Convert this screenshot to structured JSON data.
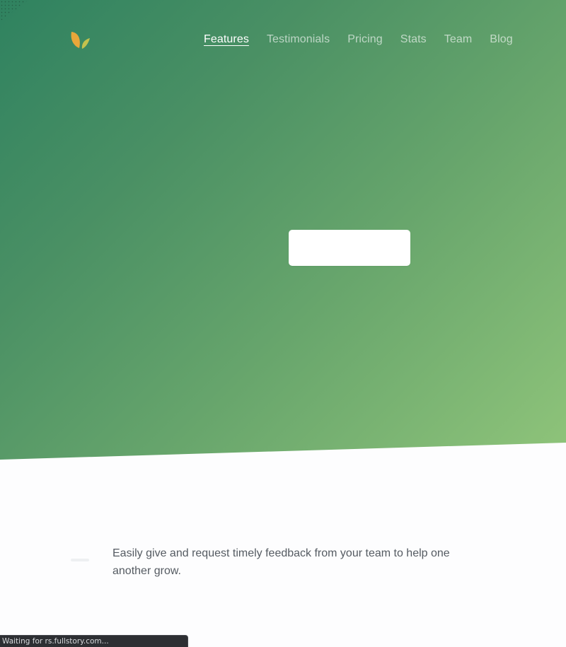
{
  "nav": {
    "items": [
      {
        "label": "Features",
        "active": true
      },
      {
        "label": "Testimonials",
        "active": false
      },
      {
        "label": "Pricing",
        "active": false
      },
      {
        "label": "Stats",
        "active": false
      },
      {
        "label": "Team",
        "active": false
      },
      {
        "label": "Blog",
        "active": false
      }
    ]
  },
  "logo": {
    "icon": "leaf-logo-icon"
  },
  "colors": {
    "hero_start": "#2f8260",
    "hero_end": "#8fc47a",
    "logo_leaf_left": "#e9a93a",
    "logo_leaf_right": "#c9c24a",
    "text_muted": "#555b62"
  },
  "features": {
    "description": "Easily give and request timely feedback from your team to help one another grow."
  },
  "status_bar": {
    "text": "Waiting for rs.fullstory.com..."
  }
}
